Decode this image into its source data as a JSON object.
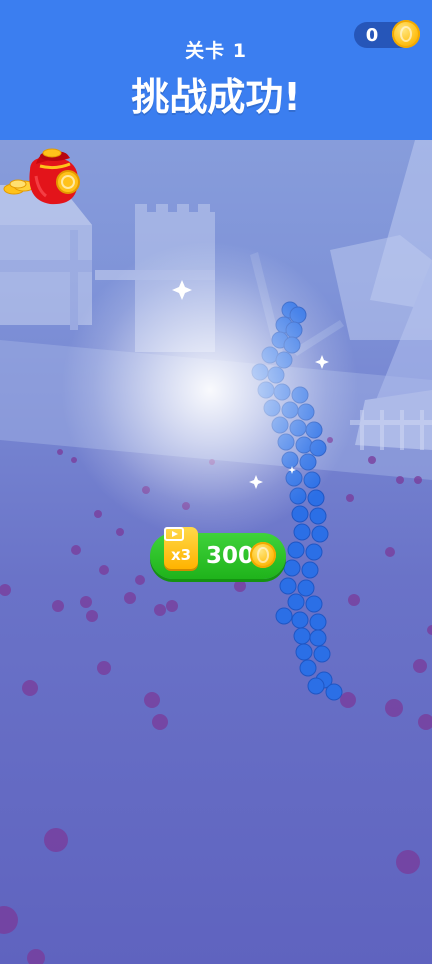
{
  "header": {
    "level_label": "关卡 1",
    "result_title": "挑战成功!"
  },
  "coins": {
    "count": "0",
    "icon": "coin-icon"
  },
  "reward": {
    "multiplier": "x3",
    "amount": "300",
    "badge_icon": "video-ad-icon",
    "coin_icon": "coin-icon"
  },
  "colors": {
    "header": "#3b7ef0",
    "button": "#2ec42a",
    "badge": "#ffc21a",
    "bag": "#e3141a"
  }
}
